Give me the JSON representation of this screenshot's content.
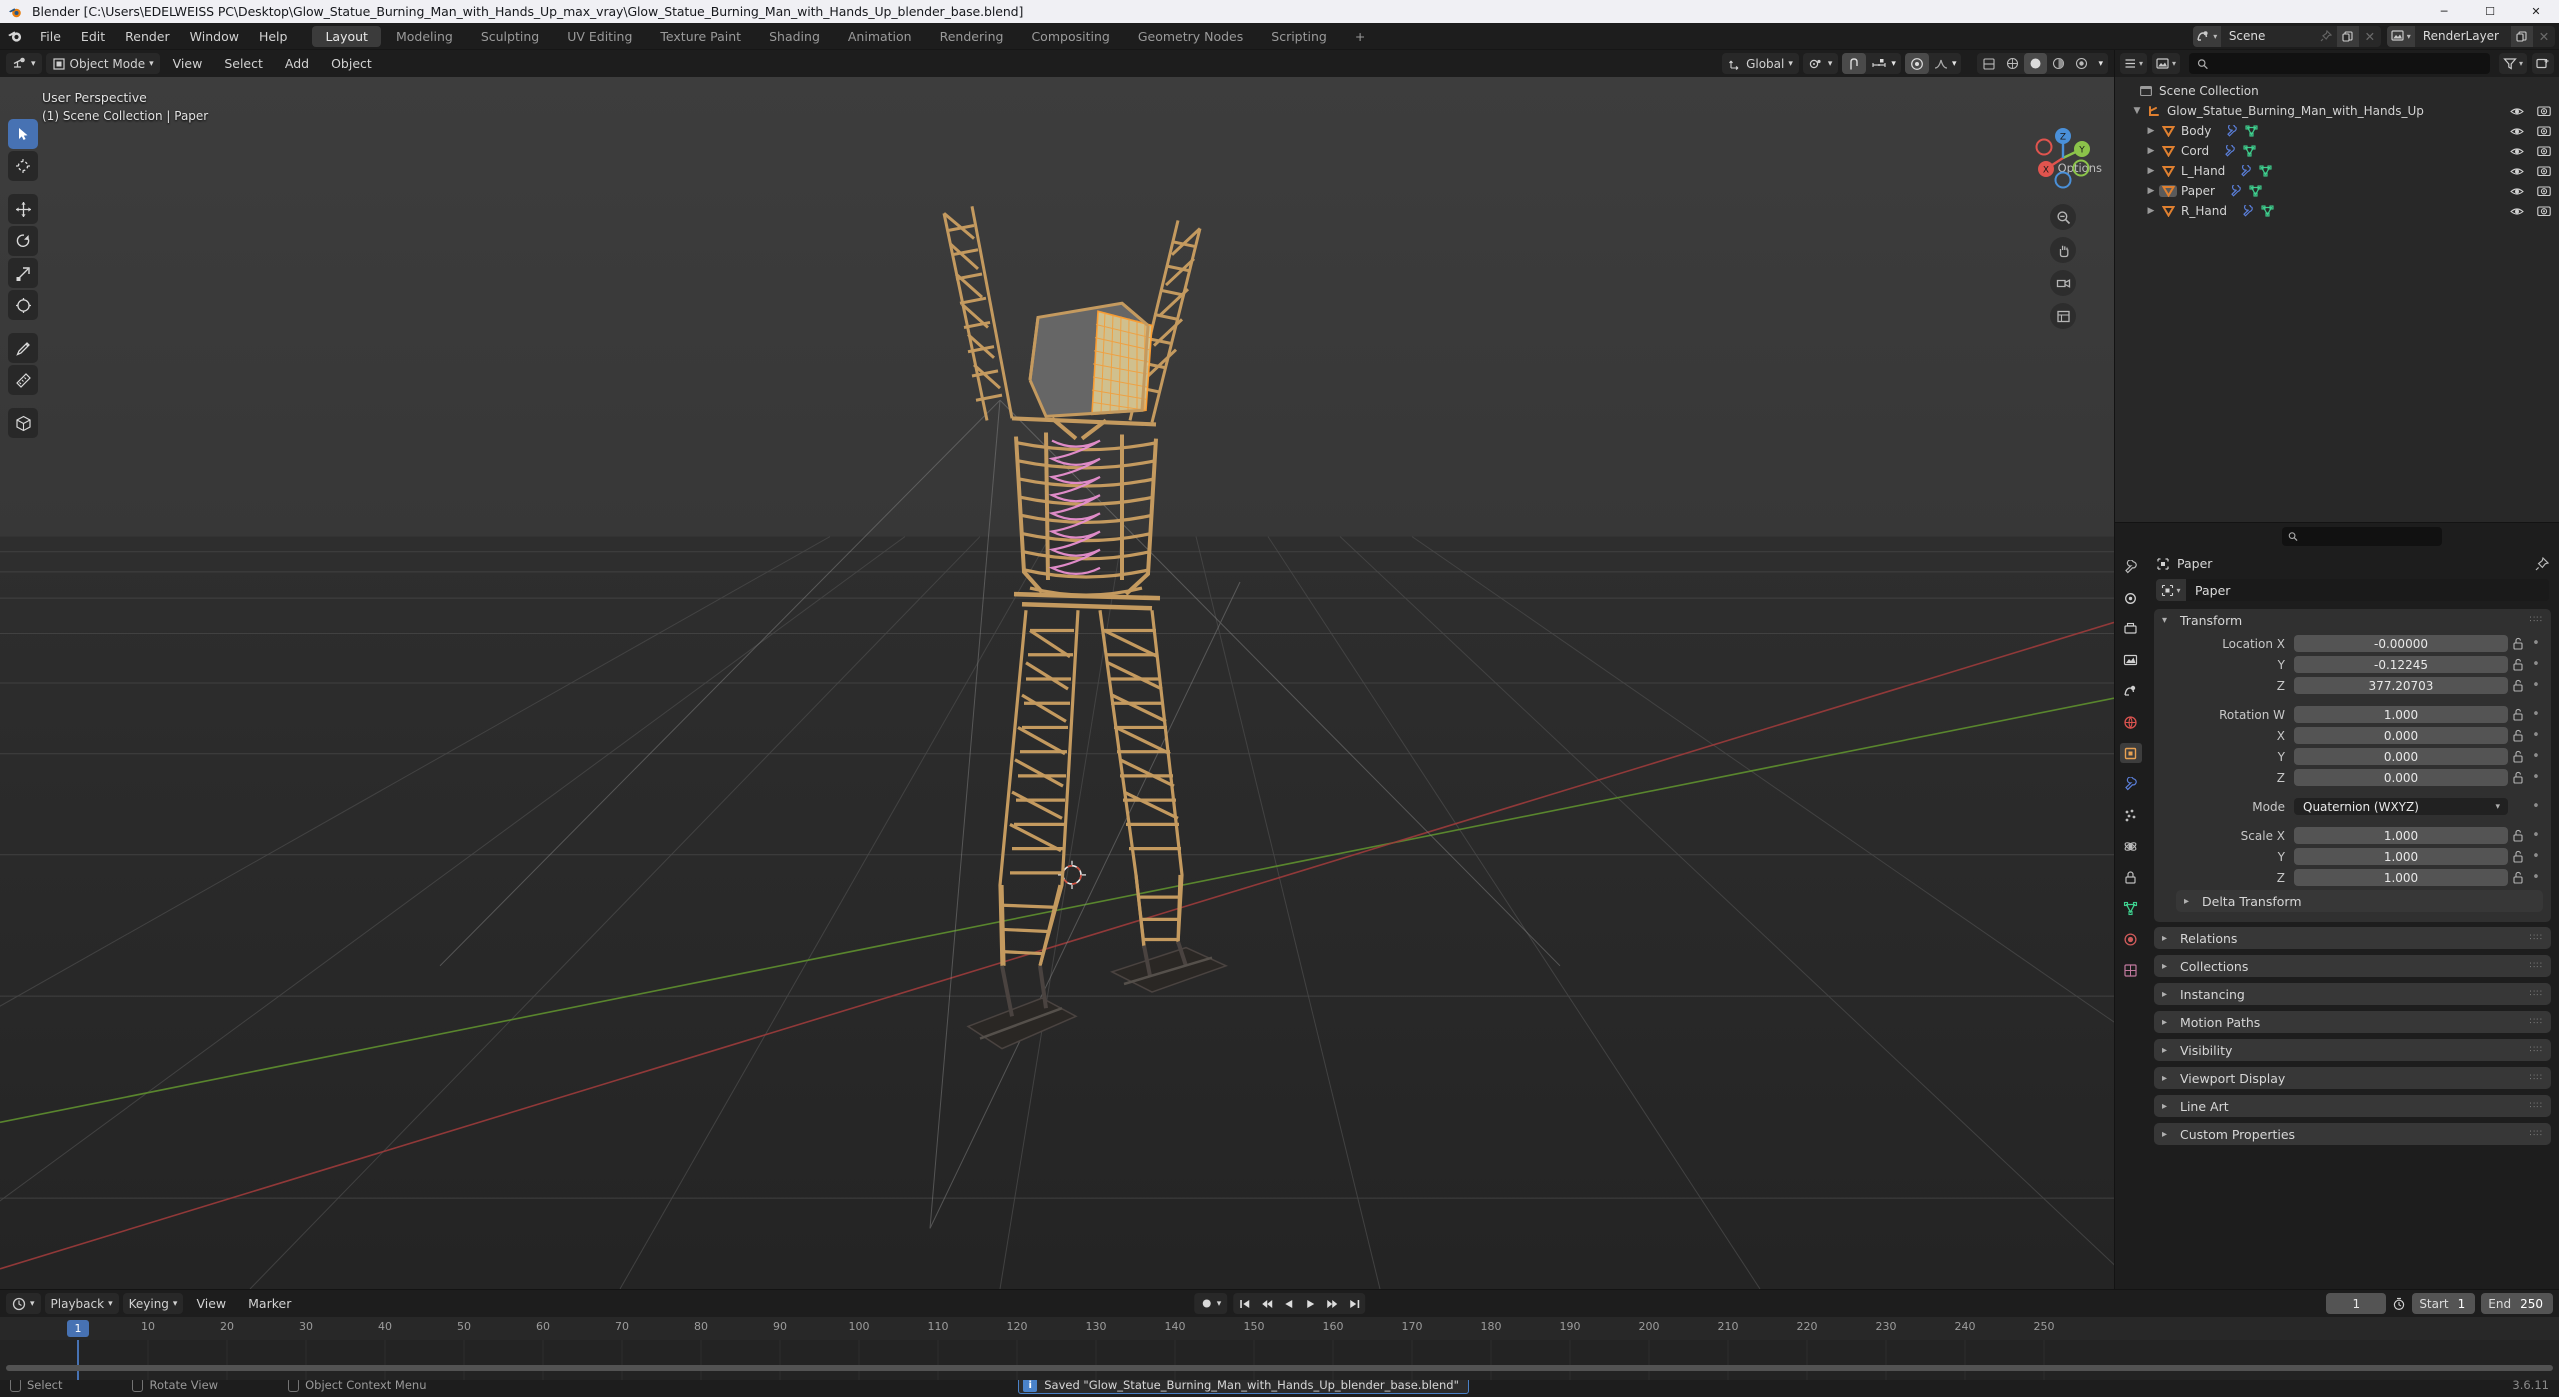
{
  "window": {
    "title": "Blender [C:\\Users\\EDELWEISS PC\\Desktop\\Glow_Statue_Burning_Man_with_Hands_Up_max_vray\\Glow_Statue_Burning_Man_with_Hands_Up_blender_base.blend]",
    "minimize": "─",
    "maximize": "☐",
    "close": "✕"
  },
  "topbar": {
    "menus": [
      "File",
      "Edit",
      "Render",
      "Window",
      "Help"
    ],
    "workspaces": [
      {
        "label": "Layout",
        "active": true
      },
      {
        "label": "Modeling",
        "active": false
      },
      {
        "label": "Sculpting",
        "active": false
      },
      {
        "label": "UV Editing",
        "active": false
      },
      {
        "label": "Texture Paint",
        "active": false
      },
      {
        "label": "Shading",
        "active": false
      },
      {
        "label": "Animation",
        "active": false
      },
      {
        "label": "Rendering",
        "active": false
      },
      {
        "label": "Compositing",
        "active": false
      },
      {
        "label": "Geometry Nodes",
        "active": false
      },
      {
        "label": "Scripting",
        "active": false
      },
      {
        "label": "+",
        "active": false
      }
    ],
    "scene_name": "Scene",
    "viewlayer_name": "RenderLayer"
  },
  "viewport": {
    "mode": "Object Mode",
    "menus": [
      "View",
      "Select",
      "Add",
      "Object"
    ],
    "transform_orientation": "Global",
    "overlay_line1": "User Perspective",
    "overlay_line2": "(1) Scene Collection | Paper",
    "options_label": "Options",
    "gizmo_axes": [
      {
        "label": "X",
        "color": "#e0544e"
      },
      {
        "label": "Y",
        "color": "#8bc34a"
      },
      {
        "label": "Z",
        "color": "#4a90d9"
      }
    ],
    "tools": [
      "select-box-tool",
      "cursor-tool",
      "move-tool",
      "rotate-tool",
      "scale-tool",
      "transform-tool",
      "annotate-tool",
      "measure-tool",
      "add-cube-tool"
    ]
  },
  "outliner": {
    "search_placeholder": "",
    "display_mode": "View Layer",
    "rows": [
      {
        "label": "Scene Collection",
        "icon": "collection-icon",
        "indent": 0,
        "disclosure": "",
        "mods": [],
        "restrict": false,
        "selected": false
      },
      {
        "label": "Glow_Statue_Burning_Man_with_Hands_Up",
        "icon": "empty-axes-icon",
        "indent": 1,
        "disclosure": "▼",
        "mods": [],
        "restrict": true,
        "selected": false
      },
      {
        "label": "Body",
        "icon": "mesh-data-icon",
        "indent": 2,
        "disclosure": "▶",
        "mods": [
          "modifier-icon",
          "mesh-data-icon"
        ],
        "restrict": true,
        "selected": false
      },
      {
        "label": "Cord",
        "icon": "mesh-data-icon",
        "indent": 2,
        "disclosure": "▶",
        "mods": [
          "modifier-icon",
          "mesh-data-icon"
        ],
        "restrict": true,
        "selected": false
      },
      {
        "label": "L_Hand",
        "icon": "mesh-data-icon",
        "indent": 2,
        "disclosure": "▶",
        "mods": [
          "modifier-icon",
          "mesh-data-icon"
        ],
        "restrict": true,
        "selected": false
      },
      {
        "label": "Paper",
        "icon": "mesh-data-icon",
        "indent": 2,
        "disclosure": "▶",
        "mods": [
          "modifier-icon",
          "mesh-data-icon"
        ],
        "restrict": true,
        "selected": true
      },
      {
        "label": "R_Hand",
        "icon": "mesh-data-icon",
        "indent": 2,
        "disclosure": "▶",
        "mods": [
          "modifier-icon",
          "mesh-data-icon"
        ],
        "restrict": true,
        "selected": false
      }
    ]
  },
  "properties": {
    "search_placeholder": "",
    "breadcrumb_object": "Paper",
    "id_name": "Paper",
    "transform": {
      "title": "Transform",
      "rows": [
        {
          "label": "Location X",
          "value": "-0.00000",
          "type": "num"
        },
        {
          "label": "Y",
          "value": "-0.12245",
          "type": "num"
        },
        {
          "label": "Z",
          "value": "377.20703",
          "type": "num"
        },
        {
          "gap": true
        },
        {
          "label": "Rotation W",
          "value": "1.000",
          "type": "num"
        },
        {
          "label": "X",
          "value": "0.000",
          "type": "num"
        },
        {
          "label": "Y",
          "value": "0.000",
          "type": "num"
        },
        {
          "label": "Z",
          "value": "0.000",
          "type": "num"
        },
        {
          "gap": true
        },
        {
          "label": "Mode",
          "value": "Quaternion (WXYZ)",
          "type": "select"
        },
        {
          "gap": true
        },
        {
          "label": "Scale X",
          "value": "1.000",
          "type": "num"
        },
        {
          "label": "Y",
          "value": "1.000",
          "type": "num"
        },
        {
          "label": "Z",
          "value": "1.000",
          "type": "num"
        }
      ]
    },
    "delta_transform": "Delta Transform",
    "panels": [
      "Relations",
      "Collections",
      "Instancing",
      "Motion Paths",
      "Visibility",
      "Viewport Display",
      "Line Art",
      "Custom Properties"
    ],
    "tabs": [
      "tool-tab",
      "render-tab",
      "output-tab",
      "view-layer-tab",
      "scene-tab",
      "world-tab",
      "object-tab",
      "modifiers-tab",
      "particles-tab",
      "physics-tab",
      "constraints-tab",
      "data-tab",
      "material-tab",
      "texture-tab"
    ]
  },
  "timeline": {
    "menus": [
      "Playback",
      "Keying",
      "View",
      "Marker"
    ],
    "current_frame": "1",
    "start_label": "Start",
    "start_value": "1",
    "end_label": "End",
    "end_value": "250",
    "ticks": [
      "1",
      "10",
      "20",
      "30",
      "40",
      "50",
      "60",
      "70",
      "80",
      "90",
      "100",
      "110",
      "120",
      "130",
      "140",
      "150",
      "160",
      "170",
      "180",
      "190",
      "200",
      "210",
      "220",
      "230",
      "240",
      "250"
    ],
    "playhead": "1"
  },
  "statusbar": {
    "items": [
      {
        "key": "mouse-left-icon",
        "label": "Select"
      },
      {
        "key": "mouse-middle-icon",
        "label": "Rotate View"
      },
      {
        "key": "mouse-right-icon",
        "label": "Object Context Menu"
      }
    ],
    "message": "Saved \"Glow_Statue_Burning_Man_with_Hands_Up_blender_base.blend\"",
    "message_icon": "info-icon",
    "version": "3.6.11"
  }
}
